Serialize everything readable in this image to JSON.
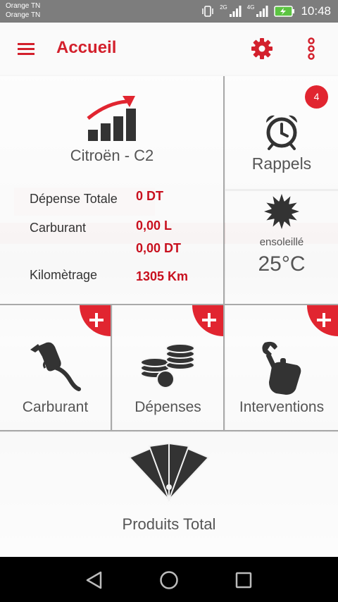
{
  "status_bar": {
    "carrier_1": "Orange TN",
    "carrier_2": "Orange TN",
    "signal_1_badge": "2G",
    "signal_2_badge": "4G",
    "time": "10:48",
    "icons": [
      "vibrate-icon",
      "signal-icon",
      "signal-icon",
      "battery-charging-icon"
    ]
  },
  "app_bar": {
    "title": "Accueil",
    "title_color": "#d3202c",
    "icons": [
      "menu-icon",
      "gear-icon",
      "more-vert-icon"
    ]
  },
  "vehicle": {
    "icon": "growth-chart-icon",
    "name": "Citroën - C2",
    "stats": [
      {
        "label": "Dépense Totale",
        "value": "0 DT"
      },
      {
        "label": "Carburant",
        "value": "0,00 L"
      },
      {
        "label": "",
        "value": "0,00 DT"
      },
      {
        "label": "Kilomètrage",
        "value": "1305 Km"
      }
    ]
  },
  "rappels": {
    "icon": "alarm-clock-icon",
    "label": "Rappels",
    "badge_count": "4"
  },
  "weather": {
    "icon": "sun-icon",
    "condition": "ensoleillé",
    "temperature": "25°C"
  },
  "actions": [
    {
      "label": "Carburant",
      "icon": "fuel-nozzle-icon"
    },
    {
      "label": "Dépenses",
      "icon": "coins-icon"
    },
    {
      "label": "Interventions",
      "icon": "wrench-hand-icon"
    }
  ],
  "produits": {
    "label": "Produits Total",
    "icon": "tag-fan-icon"
  },
  "nav_bar": {
    "icons": [
      "back-icon",
      "home-icon",
      "recents-icon"
    ]
  },
  "colors": {
    "accent": "#e12530",
    "value_text": "#c8101e",
    "icon_dark": "#333333"
  }
}
